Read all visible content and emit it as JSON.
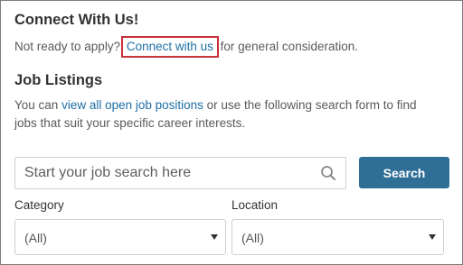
{
  "connect": {
    "heading": "Connect With Us!",
    "text_before": "Not ready to apply? ",
    "link_label": "Connect with us",
    "text_after": " for general consideration."
  },
  "jobs": {
    "heading": "Job Listings",
    "text_before": "You can ",
    "link_label": "view all open job positions",
    "text_after": " or use the following search form to find",
    "text_line2": "jobs that suit your specific career interests."
  },
  "search": {
    "placeholder": "Start your job search here",
    "value": "",
    "icon": "search-icon",
    "button_label": "Search"
  },
  "filters": {
    "category_label": "Category",
    "category_value": "(All)",
    "location_label": "Location",
    "location_value": "(All)"
  },
  "colors": {
    "link": "#1e6fa6",
    "button": "#2f6f96",
    "highlight_box": "#c8323a"
  }
}
